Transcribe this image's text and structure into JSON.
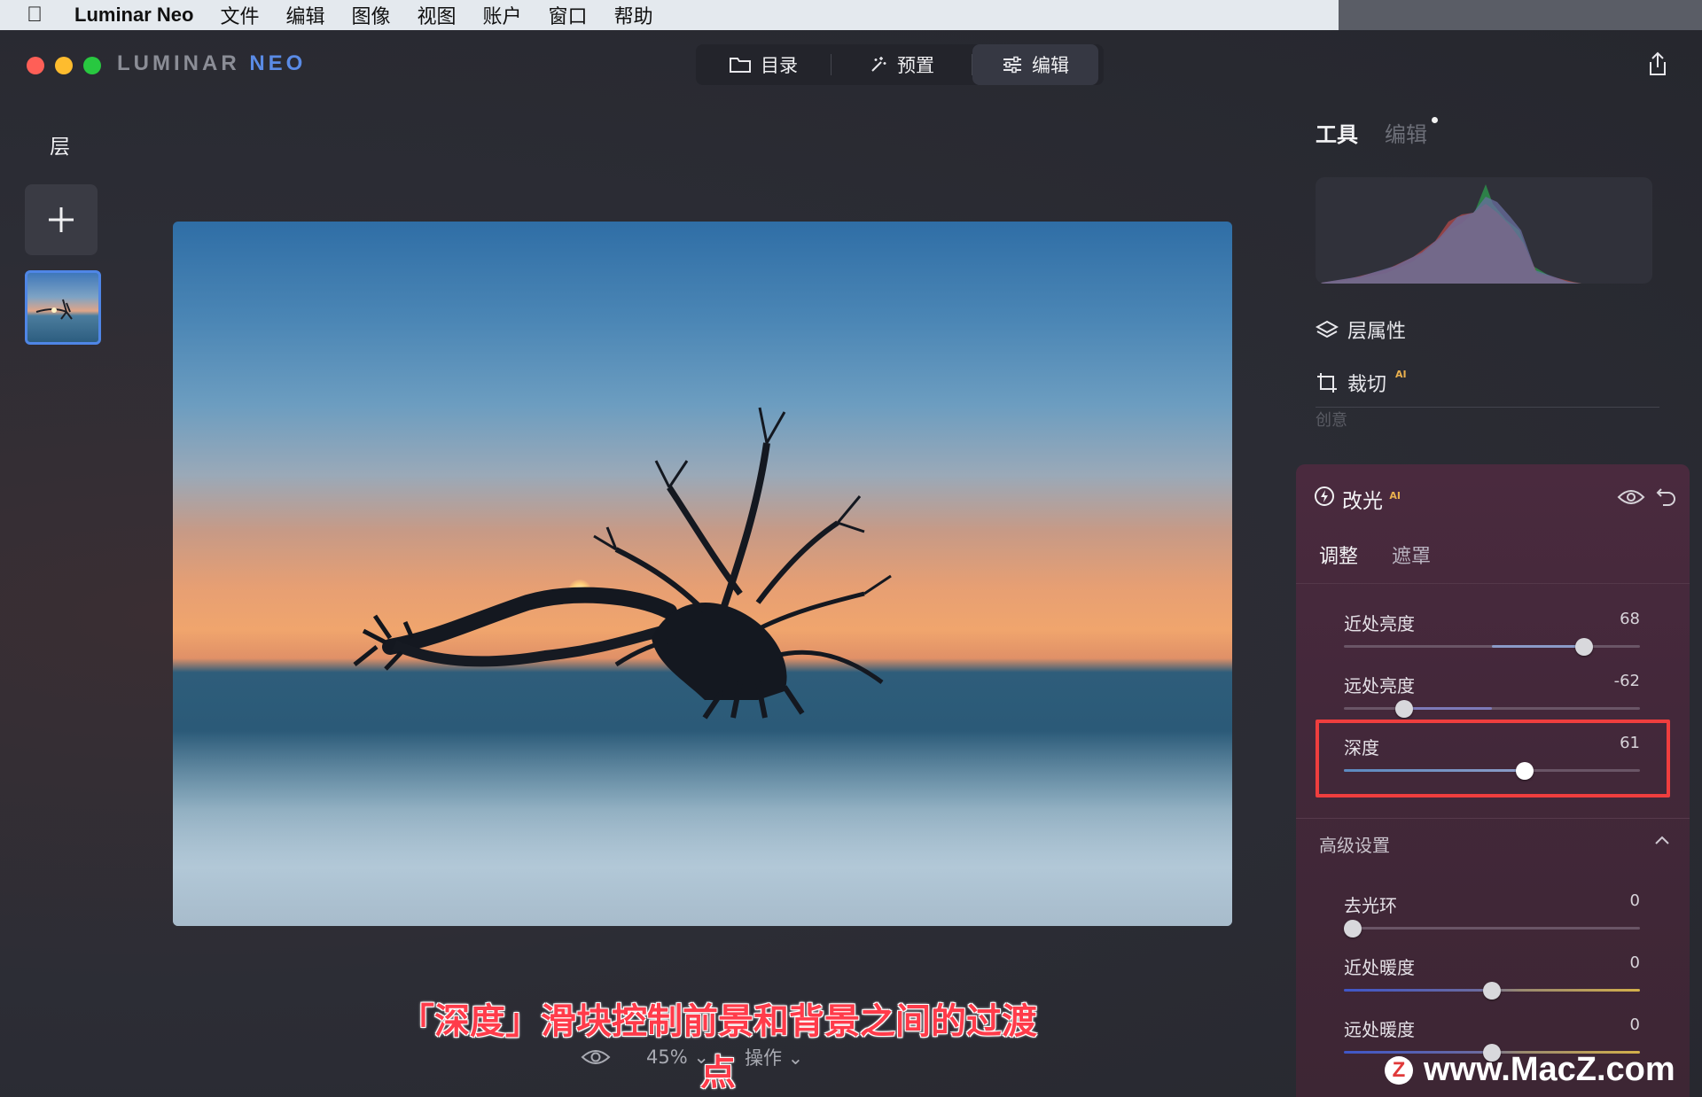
{
  "menubar": {
    "app_name": "Luminar Neo",
    "items": [
      "文件",
      "编辑",
      "图像",
      "视图",
      "账户",
      "窗口",
      "帮助"
    ]
  },
  "window": {
    "logo_a": "LUMINAR",
    "logo_b": "NEO",
    "modes": [
      {
        "label": "目录",
        "icon": "folder-icon"
      },
      {
        "label": "预置",
        "icon": "magic-wand-icon"
      },
      {
        "label": "编辑",
        "icon": "sliders-icon",
        "active": true
      }
    ]
  },
  "layers": {
    "title": "层"
  },
  "photo": {
    "caption": "「深度」滑块控制前景和背景之间的过渡点"
  },
  "bottom": {
    "zoom": "45% ⌄",
    "actions": "操作 ⌄"
  },
  "right_panel": {
    "tab_tools": "工具",
    "tab_edit": "编辑",
    "tools": [
      {
        "label": "层属性",
        "icon": "layers-icon"
      },
      {
        "label": "裁切",
        "icon": "crop-icon",
        "ai": "AI"
      }
    ],
    "faded_label": "创意",
    "relight": {
      "title": "改光",
      "ai": "AI",
      "subtab_adjust": "调整",
      "subtab_mask": "遮罩",
      "sliders": [
        {
          "label": "近处亮度",
          "value": "68"
        },
        {
          "label": "远处亮度",
          "value": "-62"
        },
        {
          "label": "深度",
          "value": "61"
        }
      ],
      "advanced_title": "高级设置",
      "advanced_sliders": [
        {
          "label": "去光环",
          "value": "0"
        },
        {
          "label": "近处暖度",
          "value": "0"
        },
        {
          "label": "远处暖度",
          "value": "0"
        }
      ]
    }
  },
  "watermark": {
    "logo": "Z",
    "text": "www.MacZ.com"
  },
  "colors": {
    "accent_blue": "#4f86e6",
    "highlight_red": "#ef3e3e",
    "caption_red": "#ff3b4a",
    "ai_badge": "#e9b04e"
  }
}
